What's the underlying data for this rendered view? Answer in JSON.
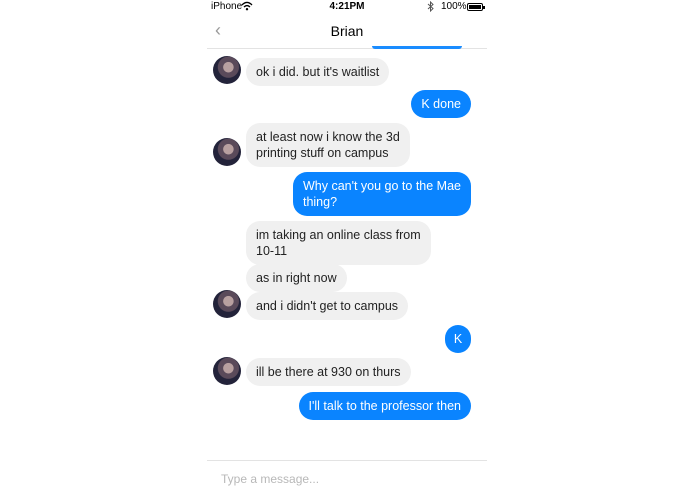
{
  "status_bar": {
    "carrier": "iPhone",
    "time": "4:21PM",
    "battery": "100%",
    "battery_level": 1.0,
    "wifi_icon": "wifi-icon",
    "bluetooth_icon": "bluetooth-icon"
  },
  "header": {
    "back_icon": "‹",
    "title": "Brian"
  },
  "messages": [
    {
      "from": "Brian",
      "text": "ok i did. but it's waitlist"
    },
    {
      "from": "me",
      "text": "K done"
    },
    {
      "from": "Brian",
      "lines": [
        "at least now i know the 3d",
        "printing stuff on campus"
      ]
    },
    {
      "from": "me",
      "lines": [
        "Why can't you go to the Mae",
        "thing?"
      ]
    },
    {
      "from": "Brian",
      "lines": [
        "im taking an online class from",
        "10-11"
      ]
    },
    {
      "from": "Brian",
      "text": "as in right now"
    },
    {
      "from": "Brian",
      "text": "and i didn't get to campus"
    },
    {
      "from": "me",
      "text": "K"
    },
    {
      "from": "Brian",
      "text": "ill be there at 930 on thurs"
    },
    {
      "from": "me",
      "text": "I'll talk to the professor then"
    }
  ],
  "composer": {
    "placeholder": "Type a message..."
  },
  "colors": {
    "outgoing_bubble": "#0a84ff",
    "incoming_bubble": "#f0f0f0"
  }
}
